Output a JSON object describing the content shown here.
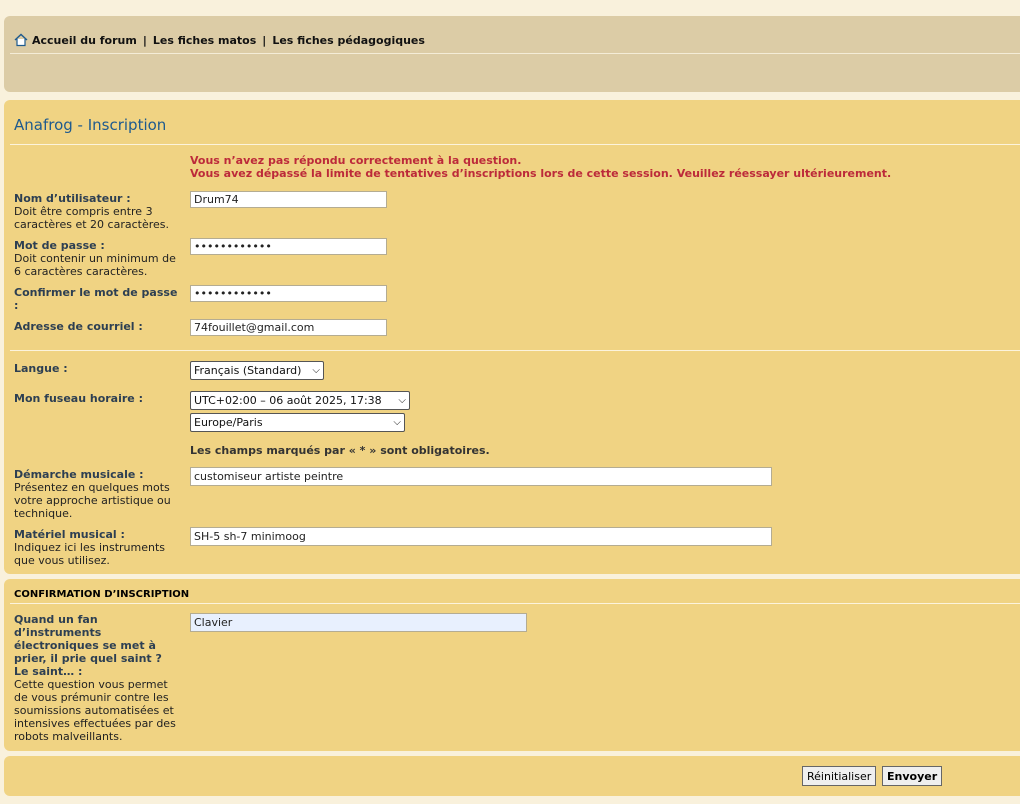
{
  "nav": {
    "links": [
      "Accueil du forum",
      "Les fiches matos",
      "Les fiches pédagogiques"
    ],
    "separator": "|"
  },
  "form": {
    "title": "Anafrog - Inscription",
    "errors": [
      "Vous n’avez pas répondu correctement à la question.",
      "Vous avez dépassé la limite de tentatives d’inscriptions lors de cette session. Veuillez réessayer ultérieurement."
    ],
    "username": {
      "label": "Nom d’utilisateur :",
      "explain": "Doit être compris entre 3 caractères et 20 caractères.",
      "value": "Drum74"
    },
    "password": {
      "label": "Mot de passe :",
      "explain": "Doit contenir un minimum de 6 caractères caractères.",
      "value": "••••••••••••"
    },
    "password_confirm": {
      "label": "Confirmer le mot de passe :",
      "value": "••••••••••••"
    },
    "email": {
      "label": "Adresse de courriel :",
      "value": "74fouillet@gmail.com"
    },
    "language": {
      "label": "Langue :",
      "selected": "Français (Standard)"
    },
    "timezone": {
      "label": "Mon fuseau horaire :",
      "selected_time": "UTC+02:00 – 06 août 2025, 17:38",
      "selected_zone": "Europe/Paris"
    },
    "required_note": "Les champs marqués par « * » sont obligatoires.",
    "musical_approach": {
      "label": "Démarche musicale :",
      "explain": "Présentez en quelques mots votre approche artistique ou technique.",
      "value": "customiseur artiste peintre"
    },
    "musical_gear": {
      "label": "Matériel musical :",
      "explain": "Indiquez ici les instruments que vous utilisez.",
      "value": "SH-5 sh-7 minimoog"
    }
  },
  "confirmation": {
    "title": "Confirmation d’inscription",
    "question": "Quand un fan d’instruments électroniques se met à prier, il prie quel saint ? Le saint… :",
    "explain": "Cette question vous permet de vous prémunir contre les soumissions automatisées et intensives effectuées par des robots malveillants.",
    "answer": "Clavier"
  },
  "buttons": {
    "reset": "Réinitialiser",
    "submit": "Envoyer"
  },
  "colors": {
    "panel": "#f0d383",
    "navbar": "#dccca6",
    "title": "#1e5a8e",
    "error": "#bc2a3a"
  },
  "icons": {
    "home": "home-icon"
  }
}
